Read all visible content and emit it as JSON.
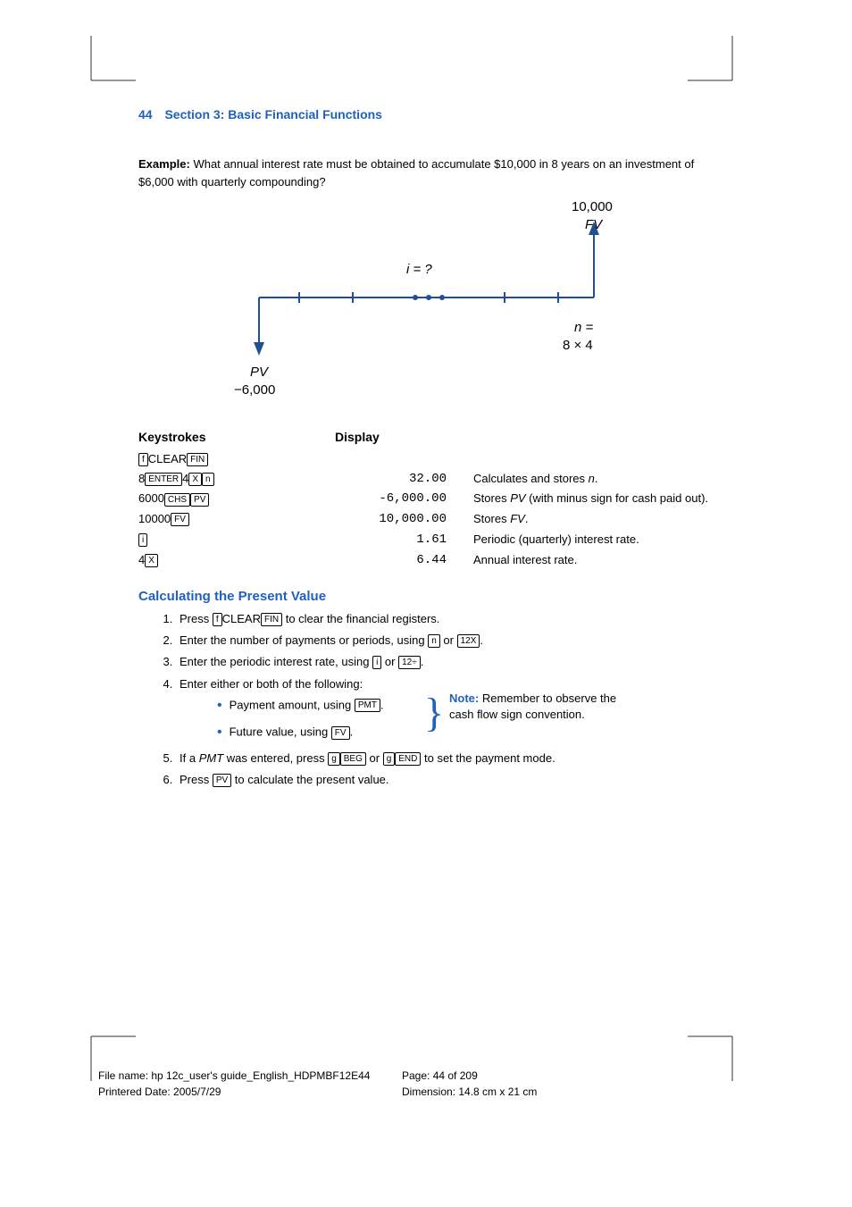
{
  "header": {
    "page_num": "44",
    "title": "Section 3: Basic Financial Functions"
  },
  "example": {
    "label": "Example:",
    "text": "What annual interest rate must be obtained to accumulate $10,000 in 8 years on an investment of $6,000 with quarterly compounding?"
  },
  "diagram": {
    "fv_val": "10,000",
    "fv_lbl": "FV",
    "i_lbl": "i = ?",
    "n_lbl": "n =",
    "n_val": "8 × 4",
    "pv_lbl": "PV",
    "pv_val": "−6,000"
  },
  "table": {
    "h_keystrokes": "Keystrokes",
    "h_display": "Display",
    "rows": [
      {
        "k_pre": "",
        "keys": [
          "f",
          "CLEAR",
          "FIN"
        ],
        "d": "",
        "e": ""
      },
      {
        "k_pre": "8",
        "mid1": "4",
        "keys": [
          "ENTER",
          "X",
          "n"
        ],
        "d": "32.00",
        "e": "Calculates and stores ",
        "e_i": "n",
        "e_post": "."
      },
      {
        "k_pre": "6000",
        "keys": [
          "CHS",
          "PV"
        ],
        "d": "-6,000.00",
        "e": "Stores ",
        "e_i": "PV",
        "e_post": " (with minus sign for cash paid out)."
      },
      {
        "k_pre": "10000",
        "keys": [
          "FV"
        ],
        "d": "10,000.00",
        "e": "Stores ",
        "e_i": "FV",
        "e_post": "."
      },
      {
        "k_pre": "",
        "keys": [
          "i"
        ],
        "d": "1.61",
        "e": "Periodic (quarterly) interest rate."
      },
      {
        "k_pre": "4",
        "keys": [
          "X"
        ],
        "d": "6.44",
        "e": "Annual interest rate."
      }
    ]
  },
  "section": {
    "title": "Calculating the Present Value",
    "step1_a": "Press ",
    "step1_b": " to clear the financial registers.",
    "step2_a": "Enter the number of payments or periods, using ",
    "step2_b": " or ",
    "step2_c": ".",
    "step3_a": "Enter the periodic interest rate, using ",
    "step3_b": " or ",
    "step3_c": ".",
    "step4": "Enter either or both of the following:",
    "bullet1_a": "Payment amount, using ",
    "bullet1_b": ".",
    "bullet2_a": "Future value, using ",
    "bullet2_b": ".",
    "note_lbl": "Note:",
    "note_txt": " Remember to observe the cash flow sign convention.",
    "step5_a": "If a ",
    "step5_i": "PMT",
    "step5_b": " was entered, press ",
    "step5_c": " or ",
    "step5_d": " to set the payment mode.",
    "step6_a": "Press ",
    "step6_b": " to calculate the present value."
  },
  "keys": {
    "f": "f",
    "CLEAR": "CLEAR",
    "FIN": "FIN",
    "ENTER": "ENTER",
    "X": "X",
    "n": "n",
    "CHS": "CHS",
    "PV": "PV",
    "FV": "FV",
    "i": "i",
    "PMT": "PMT",
    "12X": "12X",
    "12div": "12÷",
    "g": "g",
    "BEG": "BEG",
    "END": "END"
  },
  "footer": {
    "file": "File name: hp 12c_user's guide_English_HDPMBF12E44",
    "date": "Printered Date: 2005/7/29",
    "page": "Page: 44 of 209",
    "dim": "Dimension: 14.8 cm x 21 cm"
  }
}
